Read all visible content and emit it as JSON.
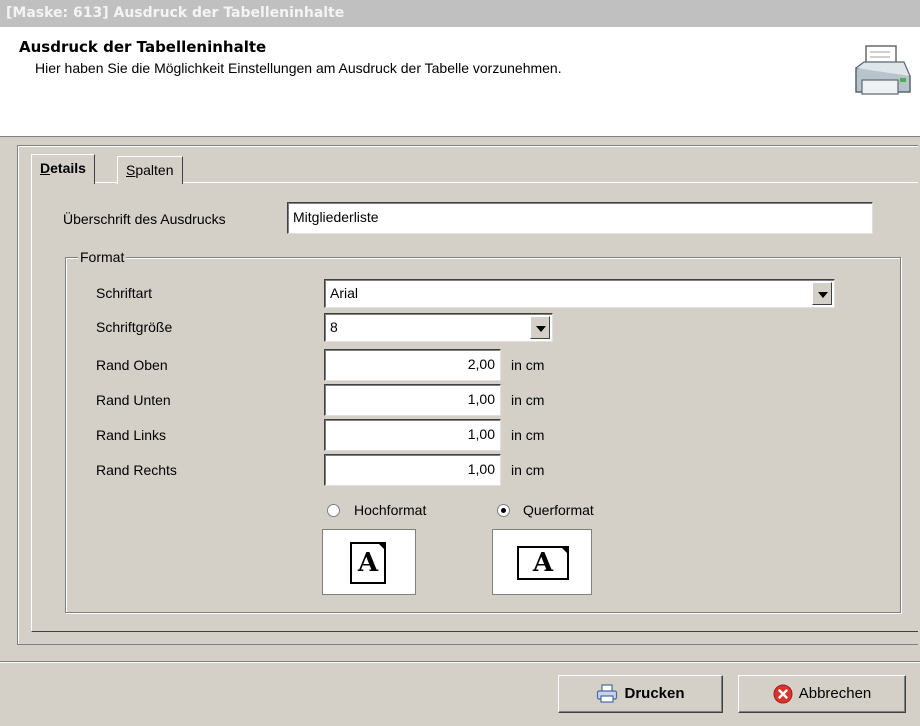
{
  "window": {
    "title": "[Maske: 613] Ausdruck der Tabelleninhalte"
  },
  "header": {
    "title": "Ausdruck der Tabelleninhalte",
    "subtitle": "Hier haben Sie die Möglichkeit Einstellungen am Ausdruck der Tabelle vorzunehmen.",
    "icon": "printer-icon"
  },
  "tabs": [
    {
      "label_first": "D",
      "label_rest": "etails",
      "active": true
    },
    {
      "label_first": "S",
      "label_rest": "palten",
      "active": false
    }
  ],
  "details": {
    "heading_label": "Überschrift des Ausdrucks",
    "heading_value": "Mitgliederliste",
    "group_label": "Format",
    "font_label": "Schriftart",
    "font_value": "Arial",
    "size_label": "Schriftgröße",
    "size_value": "8",
    "margins": [
      {
        "label": "Rand Oben",
        "value": "2,00",
        "unit": "in cm"
      },
      {
        "label": "Rand Unten",
        "value": "1,00",
        "unit": "in cm"
      },
      {
        "label": "Rand Links",
        "value": "1,00",
        "unit": "in cm"
      },
      {
        "label": "Rand Rechts",
        "value": "1,00",
        "unit": "in cm"
      }
    ],
    "orientation": {
      "portrait_label": "Hochformat",
      "landscape_label": "Querformat",
      "selected": "Querformat",
      "glyph": "A"
    }
  },
  "footer": {
    "print_label": "Drucken",
    "cancel_label": "Abbrechen",
    "print_icon": "printer-icon",
    "cancel_icon": "cancel-icon",
    "cancel_icon_color": "#d9342b"
  }
}
